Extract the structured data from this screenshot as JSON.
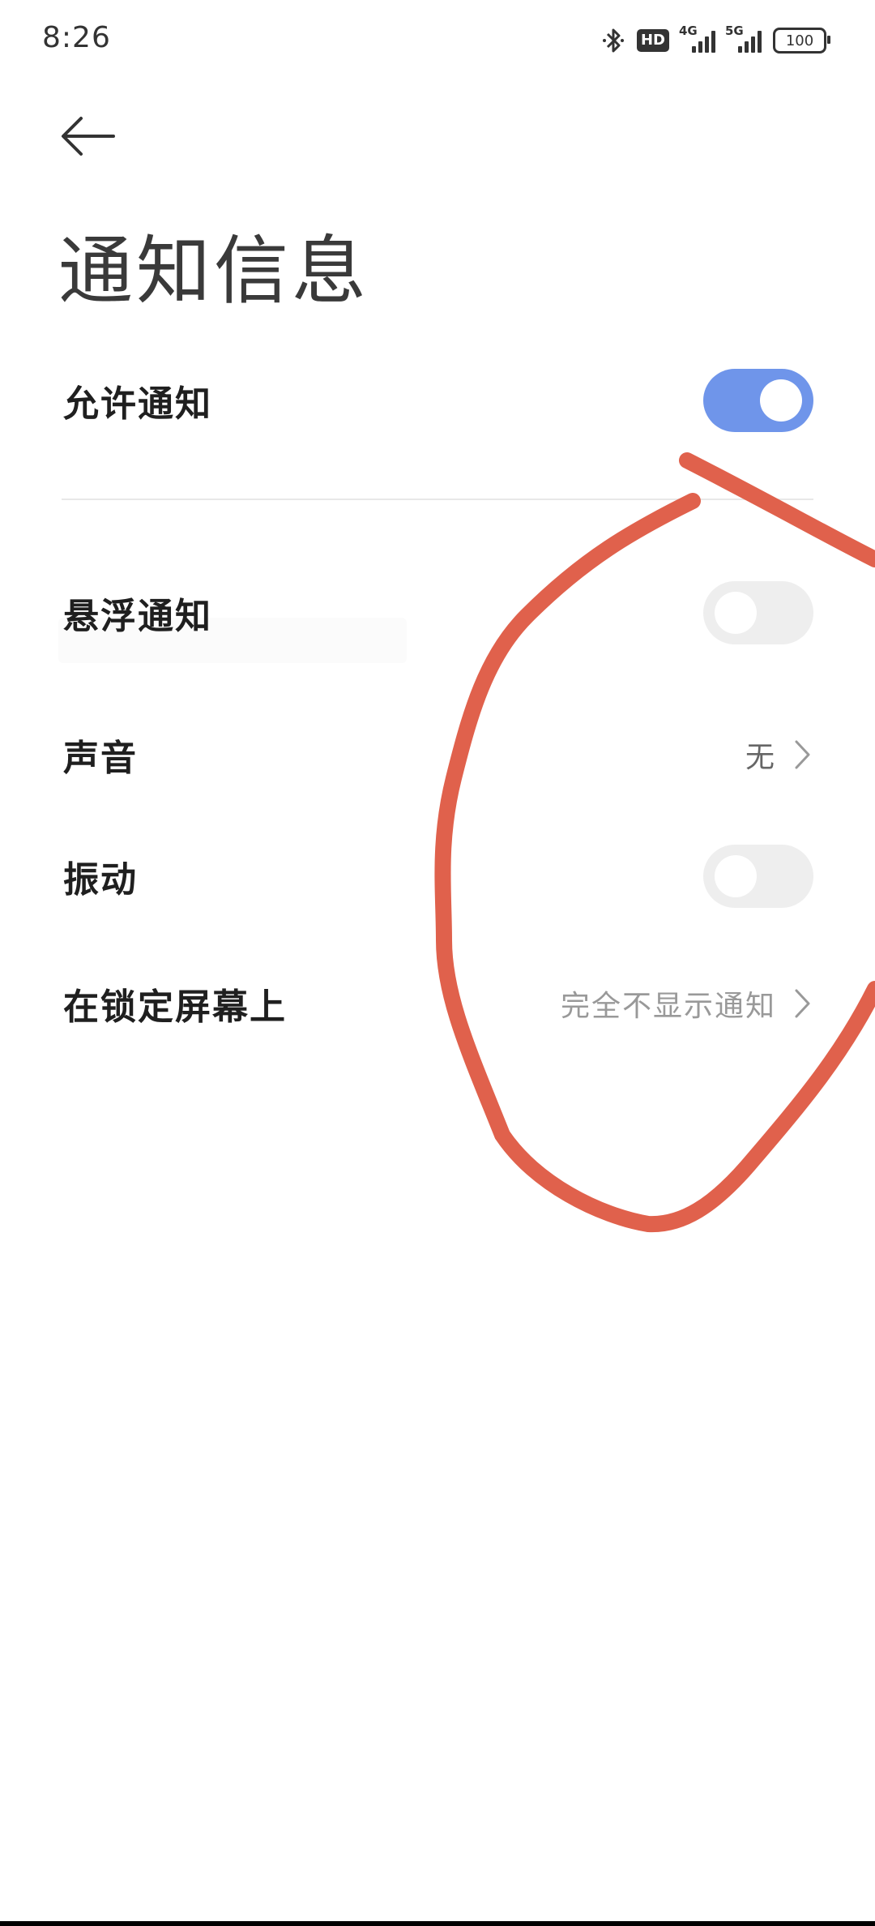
{
  "status_bar": {
    "time": "8:26",
    "hd_label": "HD",
    "net1": "4G",
    "net2": "5G",
    "battery": "100"
  },
  "page": {
    "title": "通知信息"
  },
  "settings": {
    "allow_notifications": {
      "label": "允许通知",
      "enabled": true
    },
    "floating_notifications": {
      "label": "悬浮通知",
      "enabled": false
    },
    "sound": {
      "label": "声音",
      "value": "无"
    },
    "vibration": {
      "label": "振动",
      "enabled": false
    },
    "lock_screen": {
      "label": "在锁定屏幕上",
      "value": "完全不显示通知"
    }
  },
  "colors": {
    "toggle_on": "#6f95ea",
    "toggle_off": "#eeeeee",
    "annotation": "#e0614c"
  },
  "icons": [
    "back-arrow-icon",
    "bluetooth-icon",
    "chevron-right-icon"
  ]
}
